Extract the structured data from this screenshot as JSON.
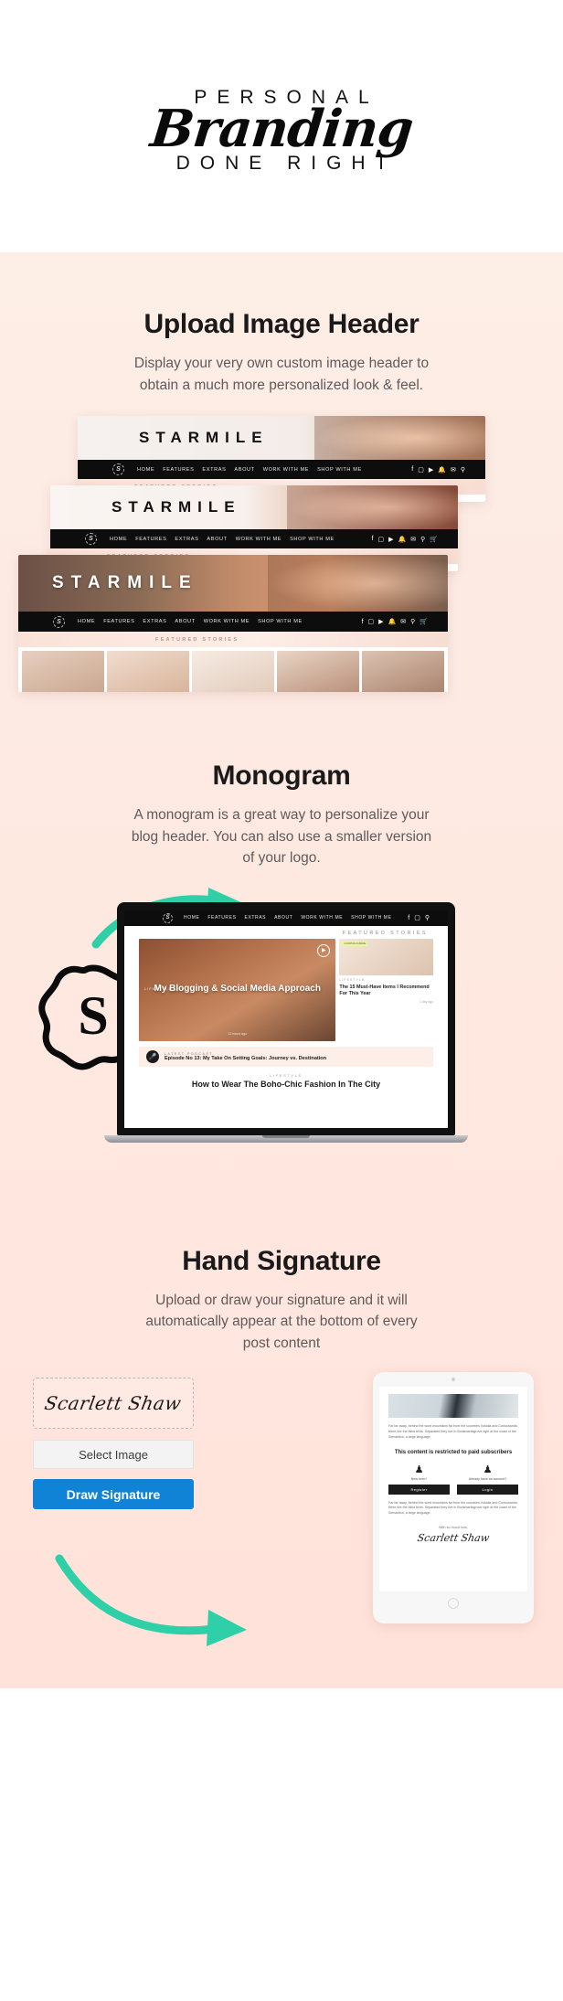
{
  "logo": {
    "top": "PERSONAL",
    "script": "Branding",
    "bottom": "DONE RIGHT"
  },
  "sections": [
    {
      "id": "upload-image-header",
      "title": "Upload Image Header",
      "description": "Display your very own custom image header to obtain a much more personalized look & feel."
    },
    {
      "id": "monogram",
      "title": "Monogram",
      "description": "A monogram  is a great way to personalize your blog header. You can also use a smaller version of your logo."
    },
    {
      "id": "hand-signature",
      "title": "Hand Signature",
      "description": "Upload or draw your signature and it will automatically appear at the bottom of every post content"
    }
  ],
  "mockup": {
    "brand": "STARMILE",
    "monogram_letter": "S",
    "nav_items": [
      "HOME",
      "FEATURES",
      "EXTRAS",
      "ABOUT",
      "WORK WITH ME",
      "SHOP WITH ME"
    ],
    "social_icons": [
      "facebook-icon",
      "instagram-icon",
      "youtube-icon",
      "snapchat-icon",
      "mail-icon",
      "search-icon",
      "cart-icon"
    ],
    "featured_label": "FEATURED STORIES"
  },
  "laptop": {
    "featured_label": "FEATURED STORIES",
    "main_post": {
      "category": "LIFESTYLE",
      "title": "My Blogging & Social Media Approach",
      "time": "11 hours ago",
      "play_icon": "play-icon"
    },
    "side_post": {
      "coupon": "COUPON INSIDE",
      "category": "LIFESTYLE",
      "title": "The 15 Must-Have Items I Recommend For This Year",
      "time": "1 day ago"
    },
    "podcast": {
      "label": "LATEST PODCAST",
      "title": "Episode No 13: My Take On Setting Goals: Journey vs. Destination",
      "icon": "microphone-icon"
    },
    "last_post": {
      "category": "LIFESTYLE",
      "title": "How to Wear The Boho-Chic Fashion In The City"
    }
  },
  "signature": {
    "name": "Scarlett Shaw",
    "select_image_label": "Select Image",
    "draw_signature_label": "Draw Signature",
    "button_color": "#1183d6"
  },
  "tablet": {
    "body_text": "Far far away, behind the word mountains far from the countries Vokalia and Consonantia, there live the blind texts. Separated they live in Bookmarksgrove right at the coast of the Semantics, a large language.",
    "restricted_title": "This content is restricted to paid subscribers",
    "col_new": {
      "label": "New here?",
      "button": "Register",
      "icon": "user-plus-icon"
    },
    "col_member": {
      "label": "Already have an account?",
      "button": "Login",
      "icon": "user-icon"
    },
    "body_text2": "Far far away, behind the word mountains far from the countries Vokalia and Consonantia, there live the blind texts. Separated they live in Bookmarksgrove right at the coast of the Semantics, a large language.",
    "thanks": "With so much love,",
    "signature": "Scarlett Shaw"
  },
  "colors": {
    "pink_bg": "#fdeee6",
    "teal_arrow": "#2fcfa8",
    "accent_blue": "#1183d6"
  }
}
